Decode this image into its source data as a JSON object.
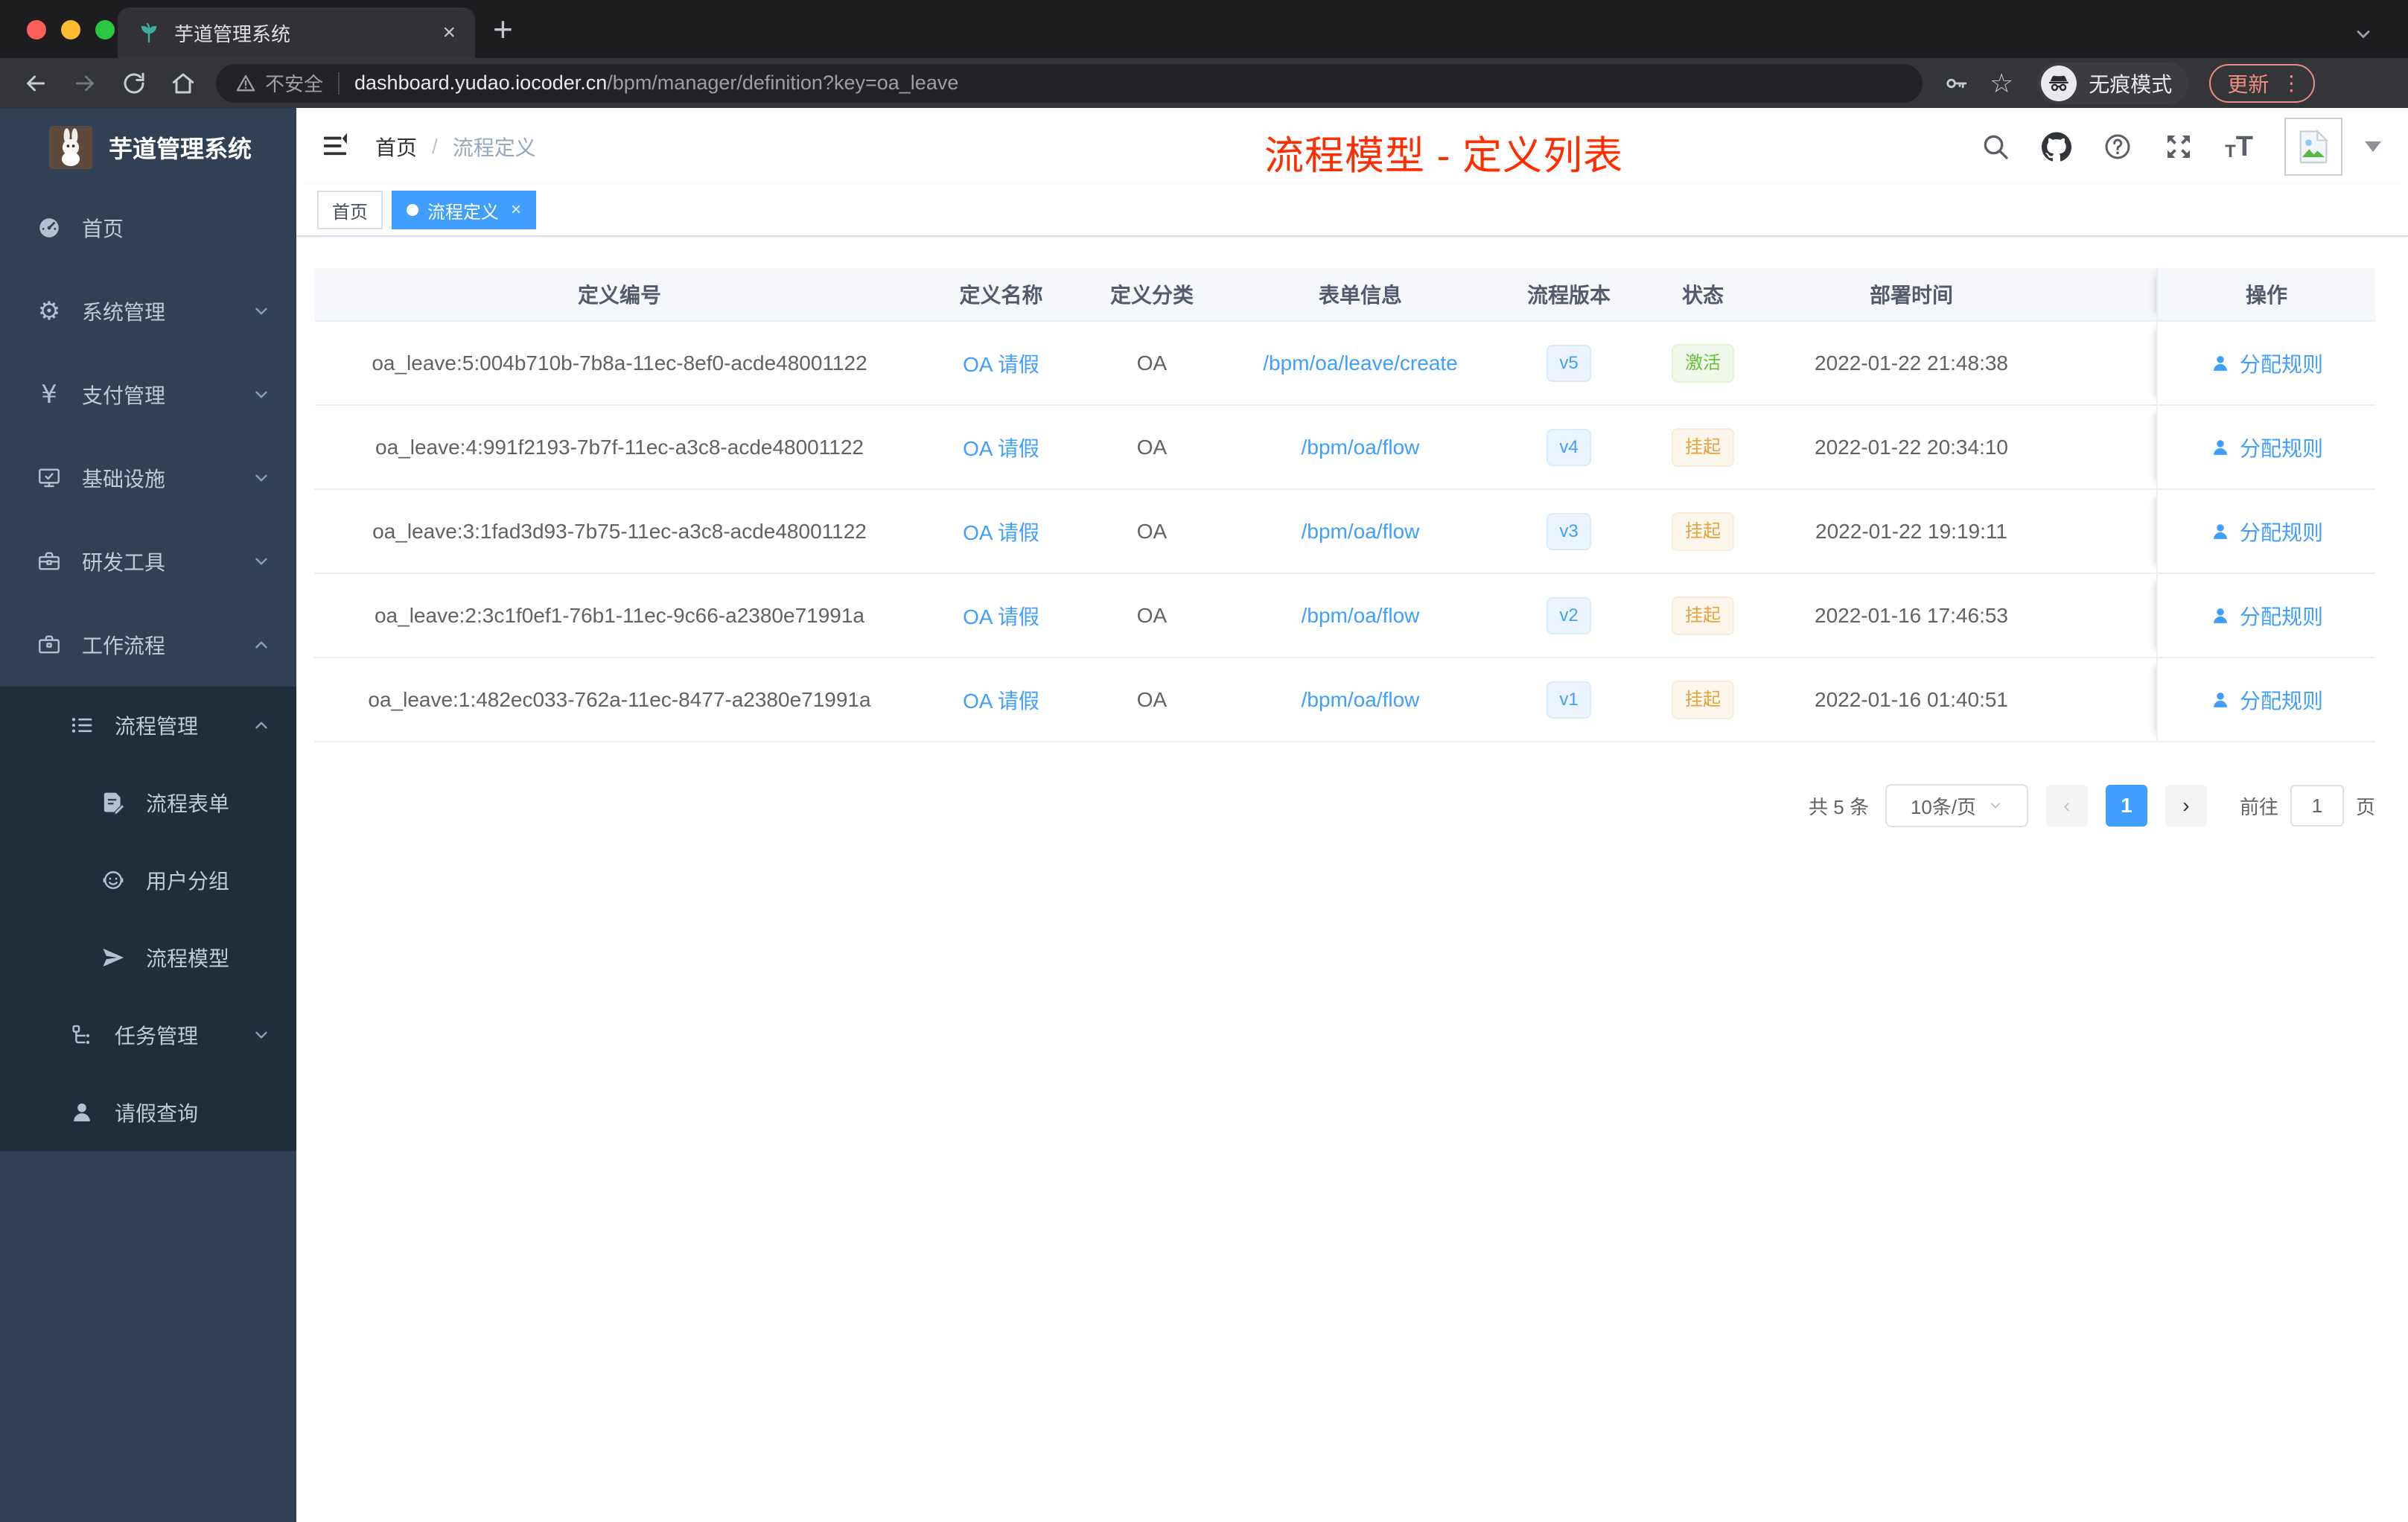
{
  "browser": {
    "tab_title": "芋道管理系统",
    "insecure_label": "不安全",
    "url_domain": "dashboard.yudao.iocoder.cn",
    "url_path": "/bpm/manager/definition?key=oa_leave",
    "incognito_label": "无痕模式",
    "update_label": "更新",
    "new_tab_glyph": "+",
    "close_tab_glyph": "×"
  },
  "sidebar": {
    "logo_title": "芋道管理系统",
    "items": [
      {
        "key": "home",
        "label": "首页",
        "icon": "dashboard-icon",
        "level": 1,
        "chevron": "",
        "in_submenu": false
      },
      {
        "key": "system",
        "label": "系统管理",
        "icon": "gear-icon",
        "level": 1,
        "chevron": "down",
        "in_submenu": false
      },
      {
        "key": "payment",
        "label": "支付管理",
        "icon": "yen-icon",
        "level": 1,
        "chevron": "down",
        "in_submenu": false
      },
      {
        "key": "infra",
        "label": "基础设施",
        "icon": "monitor-icon",
        "level": 1,
        "chevron": "down",
        "in_submenu": false
      },
      {
        "key": "devtools",
        "label": "研发工具",
        "icon": "toolbox-icon",
        "level": 1,
        "chevron": "down",
        "in_submenu": false
      },
      {
        "key": "workflow",
        "label": "工作流程",
        "icon": "briefcase-icon",
        "level": 1,
        "chevron": "up",
        "in_submenu": false
      },
      {
        "key": "process-manage",
        "label": "流程管理",
        "icon": "list-icon",
        "level": 2,
        "chevron": "up",
        "in_submenu": true
      },
      {
        "key": "process-form",
        "label": "流程表单",
        "icon": "form-icon",
        "level": 3,
        "chevron": "",
        "in_submenu": true
      },
      {
        "key": "user-group",
        "label": "用户分组",
        "icon": "people-icon",
        "level": 3,
        "chevron": "",
        "in_submenu": true
      },
      {
        "key": "process-model",
        "label": "流程模型",
        "icon": "send-icon",
        "level": 3,
        "chevron": "",
        "in_submenu": true
      },
      {
        "key": "task-manage",
        "label": "任务管理",
        "icon": "tree-icon",
        "level": 2,
        "chevron": "down",
        "in_submenu": true
      },
      {
        "key": "leave-query",
        "label": "请假查询",
        "icon": "user-icon",
        "level": 2,
        "chevron": "",
        "in_submenu": true
      }
    ]
  },
  "header": {
    "breadcrumb": [
      "首页",
      "流程定义"
    ],
    "breadcrumb_separator": "/",
    "annotation": "流程模型 - 定义列表",
    "annotation_color": "#ff2d00"
  },
  "tags": [
    {
      "label": "首页",
      "active": false
    },
    {
      "label": "流程定义",
      "active": true,
      "close_glyph": "×"
    }
  ],
  "table": {
    "columns": [
      "定义编号",
      "定义名称",
      "定义分类",
      "表单信息",
      "流程版本",
      "状态",
      "部署时间",
      "操作"
    ],
    "action_label": "分配规则",
    "rows": [
      {
        "id": "oa_leave:5:004b710b-7b8a-11ec-8ef0-acde48001122",
        "name": "OA 请假",
        "category": "OA",
        "form": "/bpm/oa/leave/create",
        "version": "v5",
        "status": "激活",
        "status_type": "success",
        "deploy_time": "2022-01-22 21:48:38",
        "action": "分配规则"
      },
      {
        "id": "oa_leave:4:991f2193-7b7f-11ec-a3c8-acde48001122",
        "name": "OA 请假",
        "category": "OA",
        "form": "/bpm/oa/flow",
        "version": "v4",
        "status": "挂起",
        "status_type": "warning",
        "deploy_time": "2022-01-22 20:34:10",
        "action": "分配规则"
      },
      {
        "id": "oa_leave:3:1fad3d93-7b75-11ec-a3c8-acde48001122",
        "name": "OA 请假",
        "category": "OA",
        "form": "/bpm/oa/flow",
        "version": "v3",
        "status": "挂起",
        "status_type": "warning",
        "deploy_time": "2022-01-22 19:19:11",
        "action": "分配规则"
      },
      {
        "id": "oa_leave:2:3c1f0ef1-76b1-11ec-9c66-a2380e71991a",
        "name": "OA 请假",
        "category": "OA",
        "form": "/bpm/oa/flow",
        "version": "v2",
        "status": "挂起",
        "status_type": "warning",
        "deploy_time": "2022-01-16 17:46:53",
        "action": "分配规则"
      },
      {
        "id": "oa_leave:1:482ec033-762a-11ec-8477-a2380e71991a",
        "name": "OA 请假",
        "category": "OA",
        "form": "/bpm/oa/flow",
        "version": "v1",
        "status": "挂起",
        "status_type": "warning",
        "deploy_time": "2022-01-16 01:40:51",
        "action": "分配规则"
      }
    ]
  },
  "pagination": {
    "total_label": "共 5 条",
    "page_size_label": "10条/页",
    "prev_glyph": "‹",
    "next_glyph": "›",
    "current_page": "1",
    "goto_label": "前往",
    "goto_value": "1",
    "page_unit_label": "页"
  },
  "colors": {
    "accent_blue": "#409eff",
    "status_active_green": "#67c23a",
    "status_suspend_orange": "#e6a23c",
    "annotation_red": "#ff2d00",
    "sidebar_bg": "#304156",
    "submenu_bg": "#1f2d3d"
  }
}
